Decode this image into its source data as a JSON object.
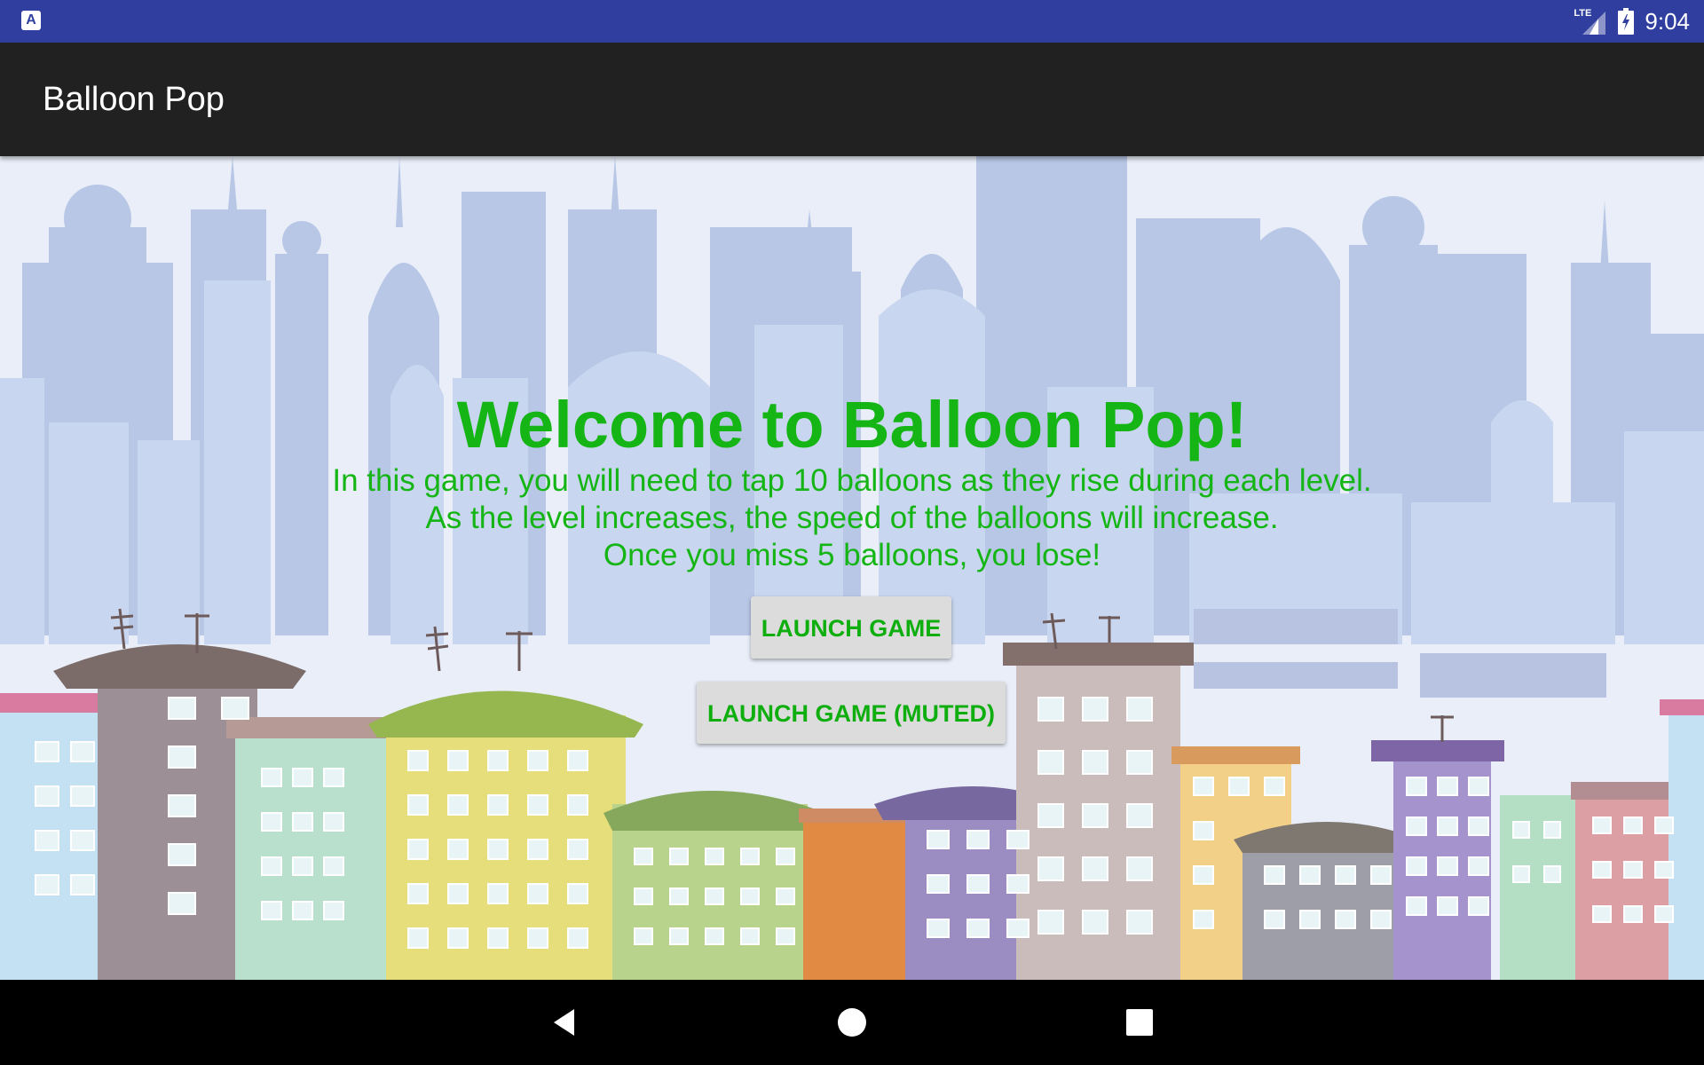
{
  "status_bar": {
    "notification_icon": "android-text-notification-icon",
    "notification_glyph": "A",
    "network_label": "LTE",
    "network_icon": "lte-signal-icon",
    "battery_icon": "battery-charging-icon",
    "time": "9:04",
    "background_color": "#303f9f"
  },
  "app_bar": {
    "title": "Balloon Pop",
    "background_color": "#212121"
  },
  "main": {
    "background": "city-skyline-illustration",
    "welcome_title": "Welcome to Balloon Pop!",
    "instructions": [
      "In this game, you will need to tap 10 balloons as they rise during each level.",
      "As the level increases, the speed of the balloons will increase.",
      "Once you miss 5 balloons, you lose!"
    ],
    "text_color": "#14b514",
    "launch_button_label": "LAUNCH GAME",
    "launch_muted_button_label": "LAUNCH GAME (MUTED)"
  },
  "nav_bar": {
    "back_icon": "back-triangle-icon",
    "home_icon": "home-circle-icon",
    "recents_icon": "recents-square-icon"
  }
}
